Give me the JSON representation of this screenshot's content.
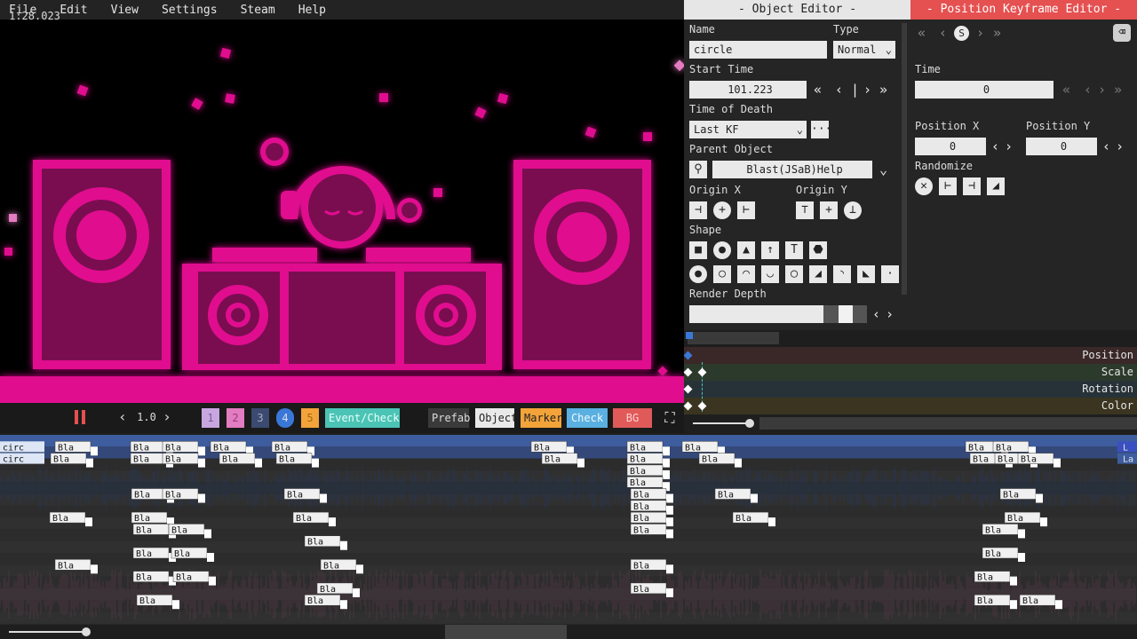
{
  "menu": [
    "File",
    "Edit",
    "View",
    "Settings",
    "Steam",
    "Help"
  ],
  "colors": {
    "accent_pink": "#e0108f",
    "dark_pink": "#7a0a50",
    "keyframe_red": "#e55050",
    "timeline_blue": "#3e5d9e",
    "layer1": "#c8a6e0",
    "layer2": "#e37cc0",
    "layer3": "#3a4a70",
    "layer4": "#3a78d8",
    "layer5": "#f2a33a"
  },
  "control": {
    "time": "1:28.023",
    "speed": "1.0",
    "layers": [
      "1",
      "2",
      "3",
      "4",
      "5"
    ],
    "event_check": "Event/Check",
    "prefab": "Prefab",
    "object": "Object",
    "marker": "Marker",
    "check": "Check",
    "bg": "BG"
  },
  "object_editor": {
    "title": "- Object Editor -",
    "name_label": "Name",
    "name_value": "circle",
    "type_label": "Type",
    "type_value": "Normal",
    "start_time_label": "Start Time",
    "start_time_value": "101.223",
    "time_of_death_label": "Time of Death",
    "time_of_death_value": "Last KF",
    "parent_label": "Parent Object",
    "parent_value": "Blast(JSaB)Help",
    "origin_x_label": "Origin X",
    "origin_y_label": "Origin Y",
    "shape_label": "Shape",
    "render_depth_label": "Render Depth",
    "render_depth_level": 0.88
  },
  "keyframe_editor": {
    "title": "- Position Keyframe Editor -",
    "time_label": "Time",
    "time_value": "0",
    "pos_x_label": "Position X",
    "pos_x_value": "0",
    "pos_y_label": "Position Y",
    "pos_y_value": "0",
    "randomize_label": "Randomize",
    "s_button": "S"
  },
  "kf_rows": [
    "Position",
    "Scale",
    "Rotation",
    "Color"
  ],
  "timeline": {
    "row_labels": [
      "circ",
      "circ"
    ],
    "block_label": "Bla",
    "end_labels": [
      "L",
      "La"
    ]
  }
}
